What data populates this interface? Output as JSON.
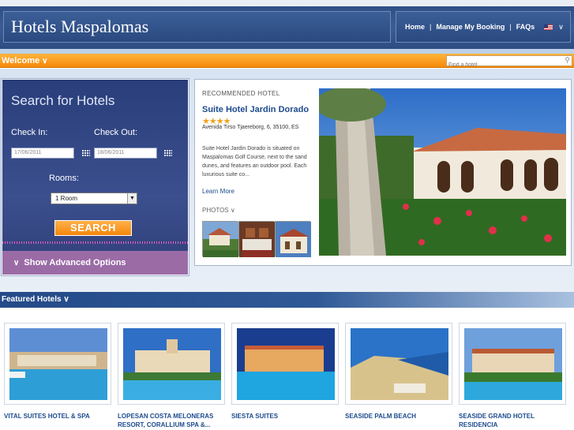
{
  "header": {
    "brand": "Hotels Maspalomas",
    "nav": [
      "Home",
      "Manage My Booking",
      "FAQs"
    ],
    "language_icon": "us-flag-icon"
  },
  "bar": {
    "welcome": "Welcome",
    "search_placeholder": "Find a hotel"
  },
  "search": {
    "title": "Search for Hotels",
    "checkin_label": "Check In:",
    "checkout_label": "Check Out:",
    "checkin_value": "17/06/2011",
    "checkout_value": "18/06/2011",
    "rooms_label": "Rooms:",
    "rooms_value": "1 Room",
    "button": "SEARCH",
    "advanced": "Show Advanced Options"
  },
  "recommended": {
    "heading": "RECOMMENDED HOTEL",
    "name": "Suite Hotel Jardin Dorado",
    "stars": "★★★★",
    "address": "Avenida Tirso Tjaereborg, 6, 35100, ES",
    "description": "Suite Hotel Jardin Dorado is situated on Maspalomas Golf Course, next to the sand dunes, and features an outdoor pool. Each luxurious suite co...",
    "learn_more": "Learn More",
    "photos_label": "PHOTOS"
  },
  "featured": {
    "title": "Featured Hotels",
    "hotels": [
      "VITAL SUITES HOTEL & SPA",
      "LOPESAN COSTA MELONERAS RESORT, CORALLIUM SPA &...",
      "SIESTA SUITES",
      "SEASIDE PALM BEACH",
      "SEASIDE GRAND HOTEL RESIDENCIA"
    ]
  },
  "colors": {
    "header_blue": "#2f4f86",
    "orange": "#f68a0b",
    "link_blue": "#1d4b8f",
    "advanced_purple": "#9b6ba6"
  }
}
